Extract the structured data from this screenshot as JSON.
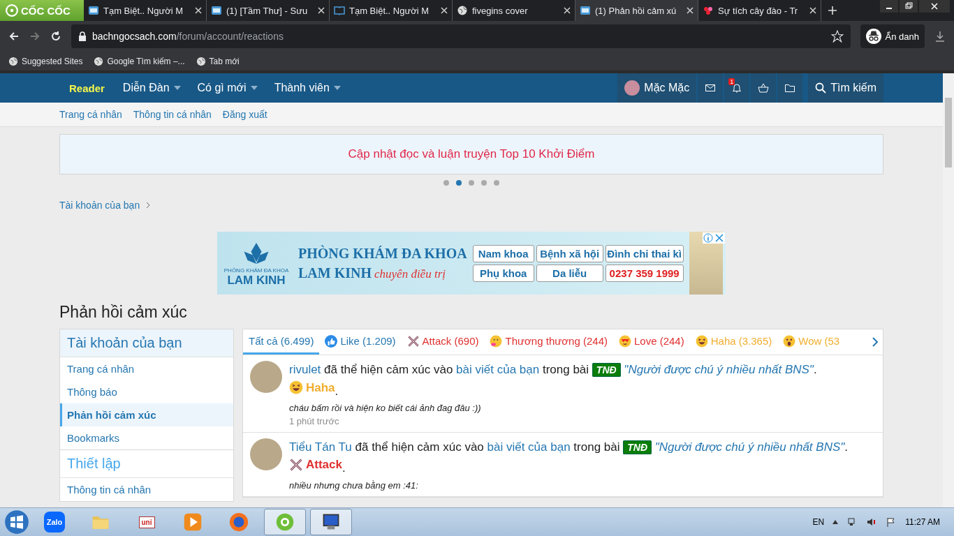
{
  "browser": {
    "logo": "CỐC CỐC",
    "tabs": [
      {
        "title": "Tạm Biệt.. Người M",
        "kind": "site",
        "selected": false
      },
      {
        "title": "(1) [Tầm Thư] - Sưu",
        "kind": "site",
        "selected": false
      },
      {
        "title": "Tạm Biệt.. Người M",
        "kind": "book",
        "selected": false
      },
      {
        "title": "fivegins cover",
        "kind": "globe",
        "selected": false
      },
      {
        "title": "(1) Phản hồi cảm xú",
        "kind": "site",
        "selected": true
      },
      {
        "title": "Sự tích cây đào - Tr",
        "kind": "flower",
        "selected": false
      }
    ],
    "address": {
      "host": "bachngocsach.com",
      "path": "/forum/account/reactions"
    },
    "profile": "Ẩn danh",
    "bookmarks": [
      {
        "label": "Suggested Sites"
      },
      {
        "label": "Google Tìm kiếm –..."
      },
      {
        "label": "Tab mới"
      }
    ]
  },
  "navbar": {
    "brand": "Reader",
    "menu": [
      {
        "label": "Diễn Đàn"
      },
      {
        "label": "Có gì mới"
      },
      {
        "label": "Thành viên"
      }
    ],
    "user": "Mặc Mặc",
    "alerts_badge": "1",
    "search": "Tìm kiếm"
  },
  "subnav": [
    {
      "label": "Trang cá nhân"
    },
    {
      "label": "Thông tin cá nhân"
    },
    {
      "label": "Đăng xuất"
    }
  ],
  "notice": {
    "text": "Cập nhật đọc và luận truyện Top 10 Khởi Điểm",
    "dots": [
      {
        "selected": false
      },
      {
        "selected": true
      },
      {
        "selected": false
      },
      {
        "selected": false
      },
      {
        "selected": false
      }
    ]
  },
  "breadcrumb": "Tài khoản của bạn",
  "ad": {
    "clinic_small": "PHÒNG KHÁM ĐA KHOA",
    "clinic_name": "LAM KINH",
    "headline_1": "PHÒNG KHÁM ĐA KHOA",
    "headline_2": "LAM KINH",
    "slogan": "chuyên điều trị",
    "services": [
      {
        "label": "Nam khoa"
      },
      {
        "label": "Bệnh xã hội"
      },
      {
        "label": "Đình chỉ thai kì"
      },
      {
        "label": "Phụ khoa"
      },
      {
        "label": "Da liễu"
      },
      {
        "label": "0237 359 1999",
        "kind": "phone"
      }
    ]
  },
  "page_title": "Phản hồi cảm xúc",
  "sidebar": {
    "sections": [
      {
        "title": "Tài khoản của bạn",
        "kind": "header",
        "items": [
          {
            "label": "Trang cá nhân",
            "selected": false
          },
          {
            "label": "Thông báo",
            "selected": false
          },
          {
            "label": "Phản hồi cảm xúc",
            "selected": true
          },
          {
            "label": "Bookmarks",
            "selected": false
          }
        ]
      },
      {
        "title": "Thiết lập",
        "kind": "plain",
        "items": [
          {
            "label": "Thông tin cá nhân",
            "selected": false
          }
        ]
      }
    ]
  },
  "reaction_tabs": [
    {
      "label": "Tất cả (6.499)",
      "kind": "all",
      "color": "#2577b1",
      "selected": true
    },
    {
      "label": "Like (1.209)",
      "kind": "like",
      "color": "#2577b1",
      "selected": false
    },
    {
      "label": "Attack (690)",
      "kind": "attack",
      "color": "#e03030",
      "selected": false
    },
    {
      "label": "Thương thương (244)",
      "kind": "hug",
      "color": "#e03030",
      "selected": false
    },
    {
      "label": "Love (244)",
      "kind": "love",
      "color": "#e03030",
      "selected": false
    },
    {
      "label": "Haha (3.365)",
      "kind": "haha",
      "color": "#f0ad2e",
      "selected": false
    },
    {
      "label": "Wow (53",
      "kind": "wow",
      "color": "#f0ad2e",
      "selected": false
    }
  ],
  "reactions": [
    {
      "user": "rivulet",
      "action": "đã thể hiện cảm xúc vào",
      "target": "bài viết của bạn",
      "preposition": "trong bài",
      "tag": "TNĐ",
      "thread": "\"Người được chú ý nhiều nhất BNS\"",
      "thread_end": ".",
      "reaction_end": ".",
      "reaction": {
        "kind": "haha",
        "label": "Haha",
        "color": "#f0ad2e"
      },
      "comment": "cháu bấm rồi và hiện ko biết cái ảnh đag đâu :))",
      "time": "1 phút trước"
    },
    {
      "user": "Tiểu Tán Tu",
      "action": "đã thể hiện cảm xúc vào",
      "target": "bài viết của bạn",
      "preposition": "trong bài",
      "tag": "TNĐ",
      "thread": "\"Người được chú ý nhiều nhất BNS\"",
      "thread_end": ".",
      "reaction_end": ".",
      "reaction": {
        "kind": "attack",
        "label": "Attack",
        "color": "#e03030"
      },
      "comment": "nhiều nhưng chưa bằng em :41:"
    }
  ],
  "taskbar": {
    "apps": [
      {
        "kind": "zalo",
        "label": "Zalo",
        "selected": false
      },
      {
        "kind": "folder",
        "selected": false
      },
      {
        "kind": "unikey",
        "label": "uni",
        "selected": false
      },
      {
        "kind": "media",
        "selected": false
      },
      {
        "kind": "firefox",
        "selected": false
      },
      {
        "kind": "coccoc",
        "selected": true
      },
      {
        "kind": "keyboard",
        "selected": true
      }
    ],
    "language": "EN",
    "time": "11:27 AM"
  }
}
